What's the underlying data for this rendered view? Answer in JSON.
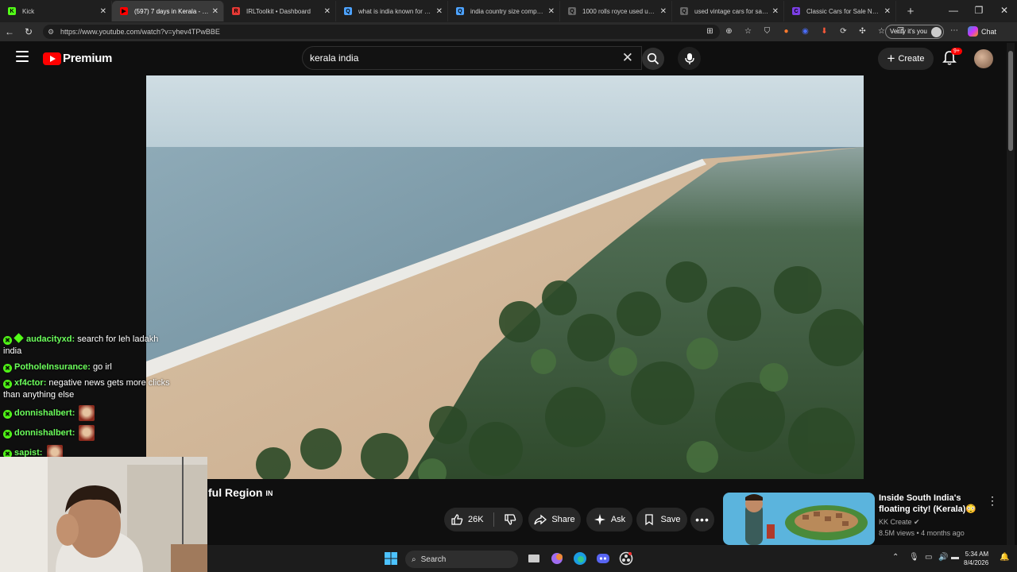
{
  "browser": {
    "tabs": [
      {
        "label": "Kick",
        "favicon_color": "#53fc18",
        "favicon_glyph": "K"
      },
      {
        "label": "(597) 7 days in Kerala - India's",
        "favicon_color": "#ff0000",
        "favicon_glyph": "▶",
        "active": true
      },
      {
        "label": "IRLToolkit • Dashboard",
        "favicon_color": "#e53935",
        "favicon_glyph": "R"
      },
      {
        "label": "what is india known for by th",
        "favicon_color": "#4da3ff",
        "favicon_glyph": "Q"
      },
      {
        "label": "india country size compared",
        "favicon_color": "#4da3ff",
        "favicon_glyph": "Q"
      },
      {
        "label": "1000 rolls royce used united",
        "favicon_color": "#666666",
        "favicon_glyph": "Q"
      },
      {
        "label": "used vintage cars for sale - S",
        "favicon_color": "#666666",
        "favicon_glyph": "Q"
      },
      {
        "label": "Classic Cars for Sale Near Me",
        "favicon_color": "#7b3fe4",
        "favicon_glyph": "C"
      }
    ],
    "new_tab": "+",
    "url": "https://www.youtube.com/watch?v=yhev4TPwBBE",
    "verify_label": "Verify it's you",
    "chat_label": "Chat"
  },
  "youtube": {
    "brand": "Premium",
    "search_value": "kerala india",
    "create_label": "Create",
    "notif_badge": "9+",
    "video_title_visible": "ful Region",
    "video_title_flag": "IN",
    "like_count": "26K",
    "share_label": "Share",
    "ask_label": "Ask",
    "save_label": "Save",
    "up_next": {
      "title": "Inside South India's floating city! (Kerala)😳",
      "channel": "KK Create",
      "meta": "8.5M views • 4 months ago"
    }
  },
  "chat": [
    {
      "user": "audacityxd",
      "text": "search for leh ladakh india",
      "badges": 2
    },
    {
      "user": "PotholeInsurance",
      "text": "go irl",
      "badges": 1
    },
    {
      "user": "xf4ctor",
      "text": "negative news gets more clicks than anything else",
      "badges": 1
    },
    {
      "user": "donnishalbert",
      "text": "",
      "badges": 1,
      "emote": true
    },
    {
      "user": "donnishalbert",
      "text": "",
      "badges": 1,
      "emote": true
    },
    {
      "user": "sapist",
      "text": "",
      "badges": 1,
      "emote": true
    }
  ],
  "taskbar": {
    "search_label": "Search",
    "time": "5:34 AM",
    "date": "8/4/2026"
  },
  "colors": {
    "youtube_red": "#ff0000",
    "kick_green": "#53fc18",
    "chat_username": "#6cff5c"
  }
}
